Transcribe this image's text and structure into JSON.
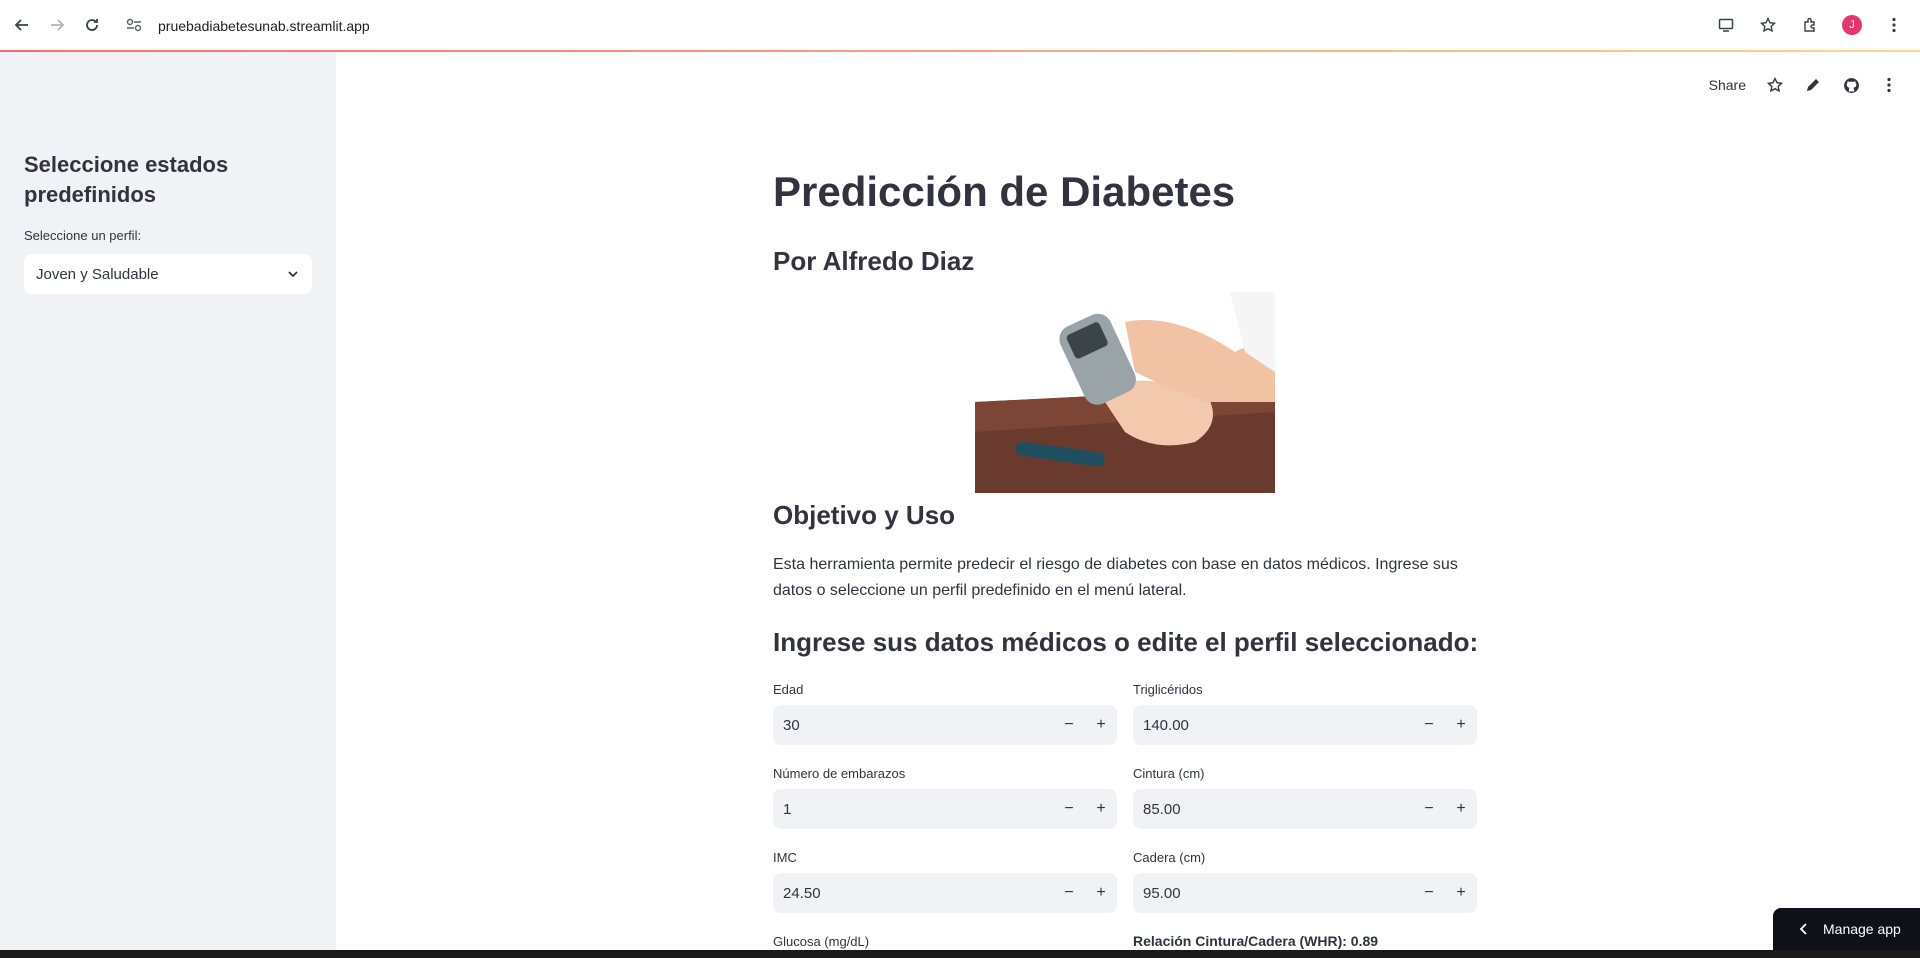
{
  "browser": {
    "url": "pruebadiabetesunab.streamlit.app",
    "avatar_letter": "J"
  },
  "sidebar": {
    "title": "Seleccione estados predefinidos",
    "select_label": "Seleccione un perfil:",
    "select_value": "Joven y Saludable"
  },
  "toolbar": {
    "share_label": "Share"
  },
  "main": {
    "title": "Predicción de Diabetes",
    "author": "Por Alfredo Diaz",
    "section_objective": "Objetivo y Uso",
    "objective_text": "Esta herramienta permite predecir el riesgo de diabetes con base en datos médicos. Ingrese sus datos o seleccione un perfil predefinido en el menú lateral.",
    "section_input": "Ingrese sus datos médicos o edite el perfil seleccionado:"
  },
  "fields": {
    "edad": {
      "label": "Edad",
      "value": "30"
    },
    "embarazos": {
      "label": "Número de embarazos",
      "value": "1"
    },
    "imc": {
      "label": "IMC",
      "value": "24.50"
    },
    "glucosa": {
      "label": "Glucosa (mg/dL)"
    },
    "trigliceridos": {
      "label": "Triglicéridos",
      "value": "140.00"
    },
    "cintura": {
      "label": "Cintura (cm)",
      "value": "85.00"
    },
    "cadera": {
      "label": "Cadera (cm)",
      "value": "95.00"
    },
    "whr": "Relación Cintura/Cadera (WHR): 0.89"
  },
  "stepper": {
    "minus": "−",
    "plus": "+"
  },
  "manage_app": "Manage app",
  "colors": {
    "accent": "#ff4b4b",
    "sidebar_bg": "#f0f2f6",
    "input_bg": "#f0f2f6",
    "text": "#31333f"
  }
}
